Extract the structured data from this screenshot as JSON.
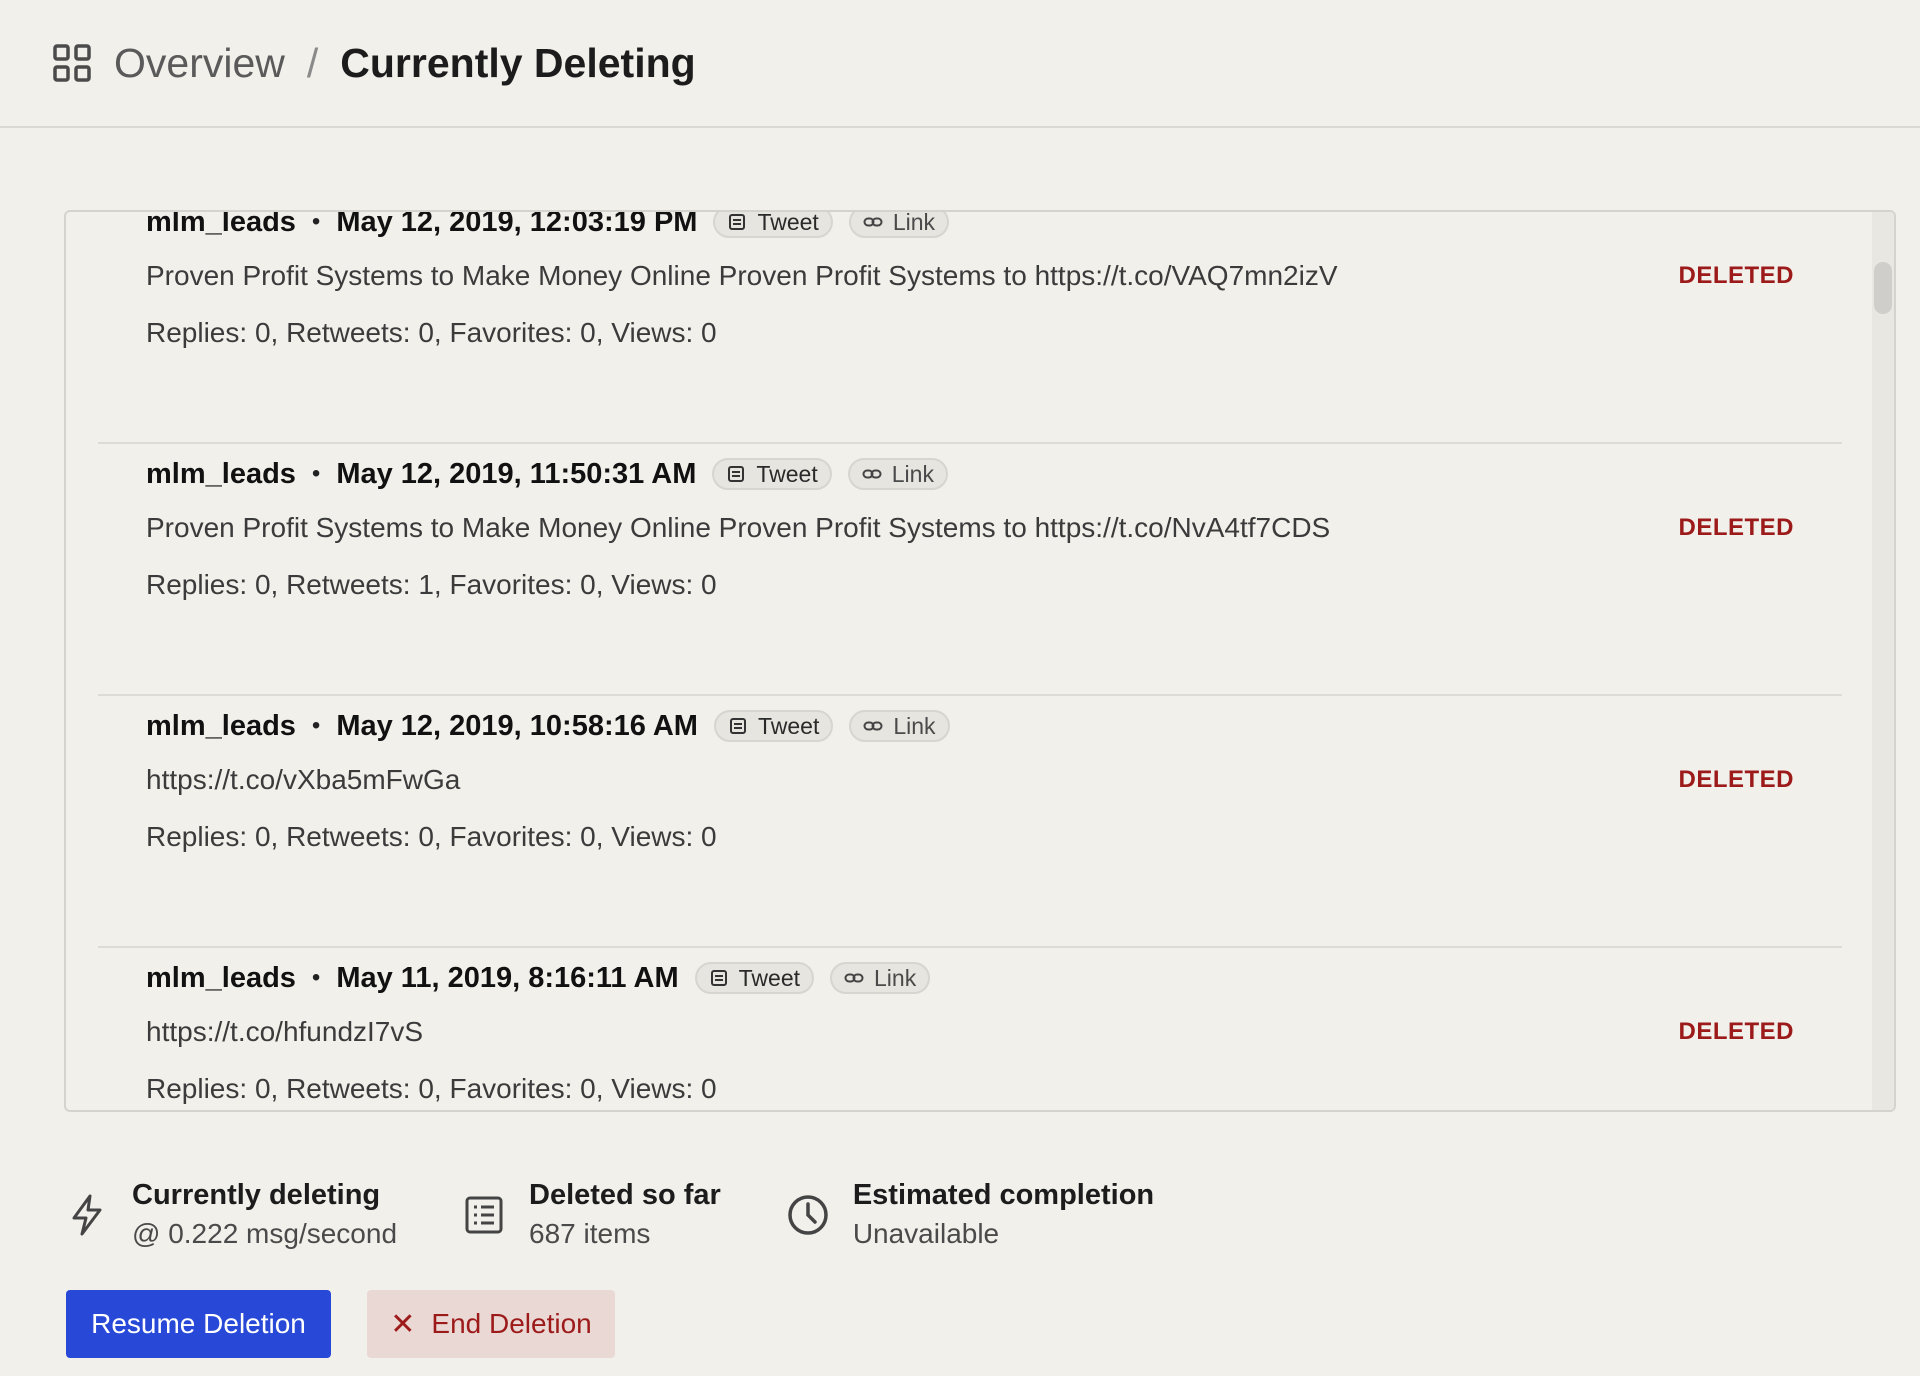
{
  "breadcrumb": {
    "parent": "Overview",
    "separator": "/",
    "current": "Currently Deleting"
  },
  "items": [
    {
      "username": "mlm_leads",
      "date": "May 12, 2019, 12:03:19 PM",
      "type_label": "Tweet",
      "link_label": "Link",
      "text": "Proven Profit Systems to Make Money Online Proven Profit Systems to  https://t.co/VAQ7mn2izV",
      "stats": "Replies: 0, Retweets: 0, Favorites: 0, Views: 0",
      "status": "DELETED"
    },
    {
      "username": "mlm_leads",
      "date": "May 12, 2019, 11:50:31 AM",
      "type_label": "Tweet",
      "link_label": "Link",
      "text": "Proven Profit Systems to Make Money Online Proven Profit Systems to  https://t.co/NvA4tf7CDS",
      "stats": "Replies: 0, Retweets: 1, Favorites: 0, Views: 0",
      "status": "DELETED"
    },
    {
      "username": "mlm_leads",
      "date": "May 12, 2019, 10:58:16 AM",
      "type_label": "Tweet",
      "link_label": "Link",
      "text": "https://t.co/vXba5mFwGa",
      "stats": "Replies: 0, Retweets: 0, Favorites: 0, Views: 0",
      "status": "DELETED"
    },
    {
      "username": "mlm_leads",
      "date": "May 11, 2019, 8:16:11 AM",
      "type_label": "Tweet",
      "link_label": "Link",
      "text": "https://t.co/hfundzI7vS",
      "stats": "Replies: 0, Retweets: 0, Favorites: 0, Views: 0",
      "status": "DELETED"
    }
  ],
  "progress": {
    "rate_label": "Currently deleting",
    "rate_value": "@ 0.222 msg/second",
    "deleted_label": "Deleted so far",
    "deleted_value": "687 items",
    "eta_label": "Estimated completion",
    "eta_value": "Unavailable"
  },
  "actions": {
    "resume_label": "Resume Deletion",
    "end_label": "End Deletion"
  },
  "icons": {
    "breadcrumb": "grid-icon",
    "tweet": "document-icon",
    "link": "link-icon",
    "rate": "lightning-icon",
    "deleted": "list-icon",
    "eta": "clock-icon",
    "end": "close-icon"
  },
  "colors": {
    "background": "#f1f0eb",
    "accent": "#2849d8",
    "danger": "#9c1a1a",
    "danger_bg": "#ead8d5"
  }
}
